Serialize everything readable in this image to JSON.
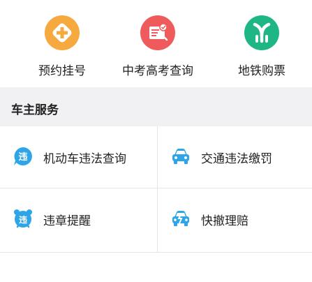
{
  "top_services": [
    {
      "label": "预约挂号",
      "icon": "hospital-cross-icon",
      "color": "#f5a93f"
    },
    {
      "label": "中考高考查询",
      "icon": "exam-certificate-icon",
      "color": "#ef5a5c"
    },
    {
      "label": "地铁购票",
      "icon": "metro-icon",
      "color": "#1fb686"
    }
  ],
  "section": {
    "title": "车主服务"
  },
  "car_services": [
    {
      "label": "机动车违法查询",
      "icon": "violation-badge-icon",
      "color": "#2ea5e8"
    },
    {
      "label": "交通违法缴罚",
      "icon": "car-icon",
      "color": "#2ea5e8"
    },
    {
      "label": "违章提醒",
      "icon": "alarm-clock-icon",
      "color": "#2ea5e8"
    },
    {
      "label": "快撤理赔",
      "icon": "car-claim-icon",
      "color": "#2ea5e8"
    }
  ],
  "colors": {
    "section_bg": "#f1f1f3",
    "divider": "#e6e6e6"
  }
}
